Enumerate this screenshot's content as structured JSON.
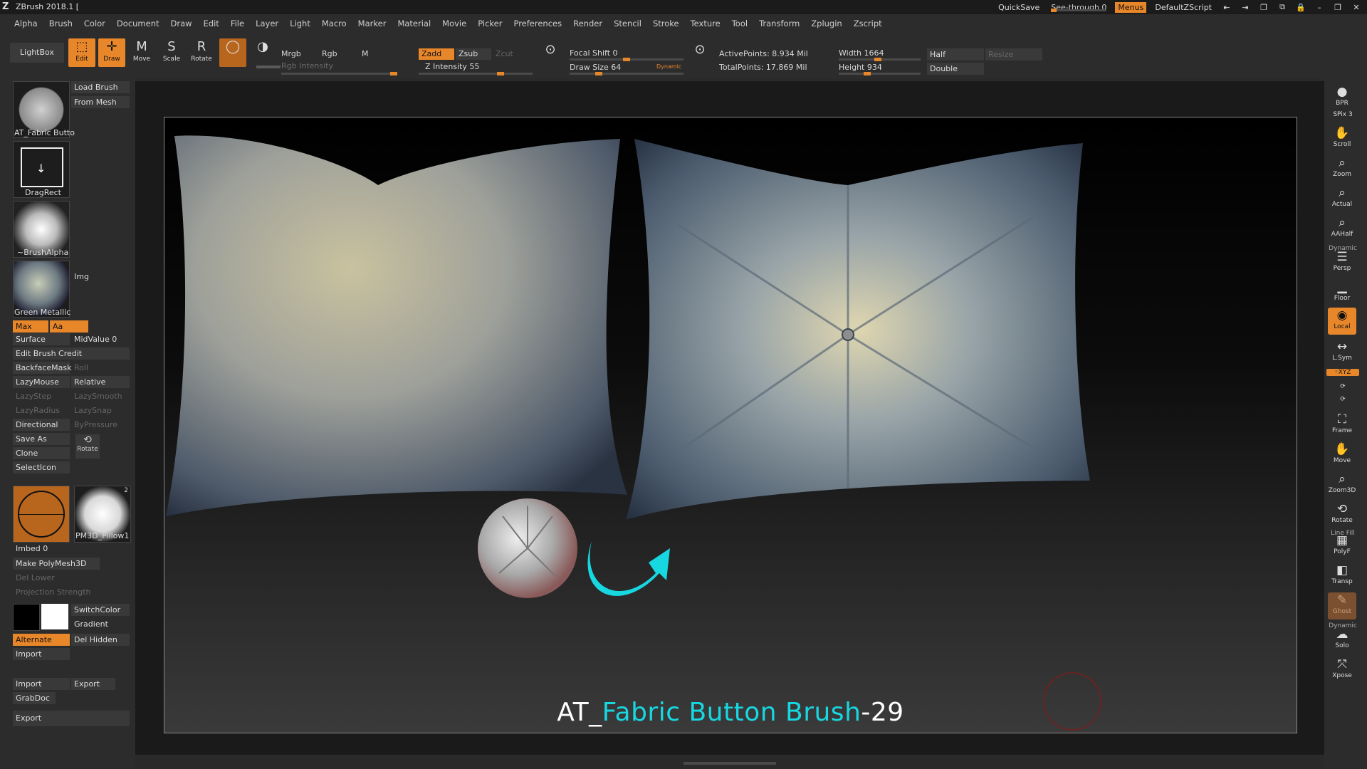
{
  "titlebar": {
    "title": "ZBrush 2018.1 [",
    "quicksave": "QuickSave",
    "see_through": "See-through   0",
    "menus": "Menus",
    "default_zscript": "DefaultZScript"
  },
  "menu": [
    "Alpha",
    "Brush",
    "Color",
    "Document",
    "Draw",
    "Edit",
    "File",
    "Layer",
    "Light",
    "Macro",
    "Marker",
    "Material",
    "Movie",
    "Picker",
    "Preferences",
    "Render",
    "Stencil",
    "Stroke",
    "Texture",
    "Tool",
    "Transform",
    "Zplugin",
    "Zscript"
  ],
  "toolbar": {
    "lightbox": "LightBox",
    "edit": "Edit",
    "draw": "Draw",
    "move": "Move",
    "scale": "Scale",
    "rotate": "Rotate",
    "mrgb": "Mrgb",
    "rgb": "Rgb",
    "m": "M",
    "rgb_intensity": "Rgb Intensity",
    "zadd": "Zadd",
    "zsub": "Zsub",
    "zcut": "Zcut",
    "z_intensity": "Z Intensity 55",
    "focal_shift": "Focal Shift 0",
    "draw_size": "Draw Size 64",
    "dynamic": "Dynamic",
    "active_points": "ActivePoints: 8.934 Mil",
    "total_points": "TotalPoints: 17.869 Mil",
    "width": "Width 1664",
    "height": "Height 934",
    "half": "Half",
    "double": "Double",
    "resize": "Resize",
    "z_intensity_level": 0.55,
    "rgb_intensity_level": 1.0
  },
  "left": {
    "load_brush": "Load Brush",
    "from_mesh": "From Mesh",
    "brush_name": "AT_Fabric Butto",
    "stroke_name": "DragRect",
    "alpha_name": "~BrushAlpha",
    "material_name": "Green Metallic",
    "img": "Img",
    "max": "Max",
    "aa": "Aa",
    "surface": "Surface",
    "midvalue": "MidValue 0",
    "edit_brush_credit": "Edit Brush Credit",
    "backfacemask": "BackfaceMask",
    "roll": "Roll",
    "lazymouse": "LazyMouse",
    "relative": "Relative",
    "lazystep": "LazyStep",
    "lazysmooth": "LazySmooth",
    "lazyradius": "LazyRadius",
    "lazysnap": "LazySnap",
    "directional": "Directional",
    "bypressure": "ByPressure",
    "save_as": "Save As",
    "rotate": "Rotate",
    "clone": "Clone",
    "selecticon": "SelectIcon",
    "tool_name": "PM3D_Pillow1",
    "tool_badge": "2",
    "imbed": "Imbed 0",
    "make_polymesh": "Make PolyMesh3D",
    "del_lower": "Del Lower",
    "projection_strength": "Projection Strength",
    "switchcolor": "SwitchColor",
    "gradient": "Gradient",
    "alternate": "Alternate",
    "del_hidden": "Del Hidden",
    "import1": "Import",
    "import2": "Import",
    "export1": "Export",
    "grabdoc": "GrabDoc",
    "export2": "Export"
  },
  "canvas": {
    "title_a": "AT_",
    "title_b": "Fabric Button Brush",
    "title_c": "-29",
    "accent": "#17d7e0"
  },
  "right": {
    "bpr": "BPR",
    "spix": "SPix 3",
    "scroll": "Scroll",
    "zoom": "Zoom",
    "actual": "Actual",
    "aahalf": "AAHalf",
    "dynamic": "Dynamic",
    "persp": "Persp",
    "floor": "Floor",
    "local": "Local",
    "lsym": "L.Sym",
    "xyz": "◦XYZ",
    "frame": "Frame",
    "move": "Move",
    "zoom3d": "Zoom3D",
    "rotate": "Rotate",
    "linefill": "Line Fill",
    "polyf": "PolyF",
    "transp": "Transp",
    "ghost": "Ghost",
    "dynamic2": "Dynamic",
    "solo": "Solo",
    "xpose": "Xpose"
  },
  "colors": {
    "accent_orange": "#e8872a",
    "panel": "#2c2c2c"
  }
}
